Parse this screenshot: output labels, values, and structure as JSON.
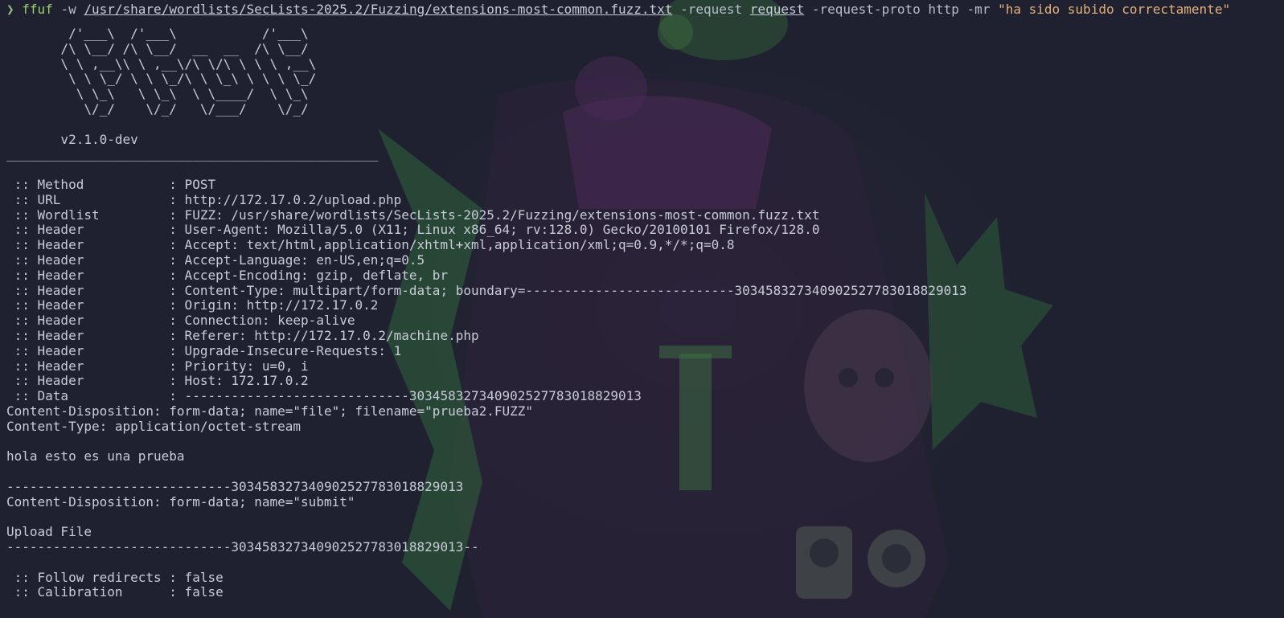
{
  "command": {
    "prompt_symbol": "❯",
    "name": "ffuf",
    "flag_w": "-w",
    "wordlist_path": "/usr/share/wordlists/SecLists-2025.2/Fuzzing/extensions-most-common.fuzz.txt",
    "flag_request": "-request",
    "request_file": "request",
    "flag_proto": "-request-proto",
    "proto_value": "http",
    "flag_mr": "-mr",
    "match_regex": "\"ha sido subido correctamente\""
  },
  "banner": [
    "        /'___\\  /'___\\           /'___\\",
    "       /\\ \\__/ /\\ \\__/  __  __  /\\ \\__/",
    "       \\ \\ ,__\\\\ \\ ,__\\/\\ \\/\\ \\ \\ \\ ,__\\",
    "        \\ \\ \\_/ \\ \\ \\_/\\ \\ \\_\\ \\ \\ \\ \\_/",
    "         \\ \\_\\   \\ \\_\\  \\ \\____/  \\ \\_\\",
    "          \\/_/    \\/_/   \\/___/    \\/_/"
  ],
  "version": "       v2.1.0-dev",
  "separator": "________________________________________________",
  "config_lines": [
    " :: Method           : POST",
    " :: URL              : http://172.17.0.2/upload.php",
    " :: Wordlist         : FUZZ: /usr/share/wordlists/SecLists-2025.2/Fuzzing/extensions-most-common.fuzz.txt",
    " :: Header           : User-Agent: Mozilla/5.0 (X11; Linux x86_64; rv:128.0) Gecko/20100101 Firefox/128.0",
    " :: Header           : Accept: text/html,application/xhtml+xml,application/xml;q=0.9,*/*;q=0.8",
    " :: Header           : Accept-Language: en-US,en;q=0.5",
    " :: Header           : Accept-Encoding: gzip, deflate, br",
    " :: Header           : Content-Type: multipart/form-data; boundary=---------------------------303458327340902527783018829013",
    " :: Header           : Origin: http://172.17.0.2",
    " :: Header           : Connection: keep-alive",
    " :: Header           : Referer: http://172.17.0.2/machine.php",
    " :: Header           : Upgrade-Insecure-Requests: 1",
    " :: Header           : Priority: u=0, i",
    " :: Header           : Host: 172.17.0.2",
    " :: Data             : -----------------------------303458327340902527783018829013"
  ],
  "data_lines": [
    "Content-Disposition: form-data; name=\"file\"; filename=\"prueba2.FUZZ\"",
    "Content-Type: application/octet-stream",
    "",
    "hola esto es una prueba",
    "",
    "-----------------------------303458327340902527783018829013",
    "Content-Disposition: form-data; name=\"submit\"",
    "",
    "Upload File",
    "-----------------------------303458327340902527783018829013--",
    ""
  ],
  "options_lines": [
    " :: Follow redirects : false",
    " :: Calibration      : false"
  ],
  "colors": {
    "background": "#1f2130",
    "foreground": "#c8cbd8",
    "command": "#9ad16b",
    "string": "#e3b07a",
    "wallpaper_green": "#3a7a3a",
    "wallpaper_purple": "#4a2a55"
  },
  "icons": {
    "wallpaper": "illustrated-character-wallpaper"
  }
}
